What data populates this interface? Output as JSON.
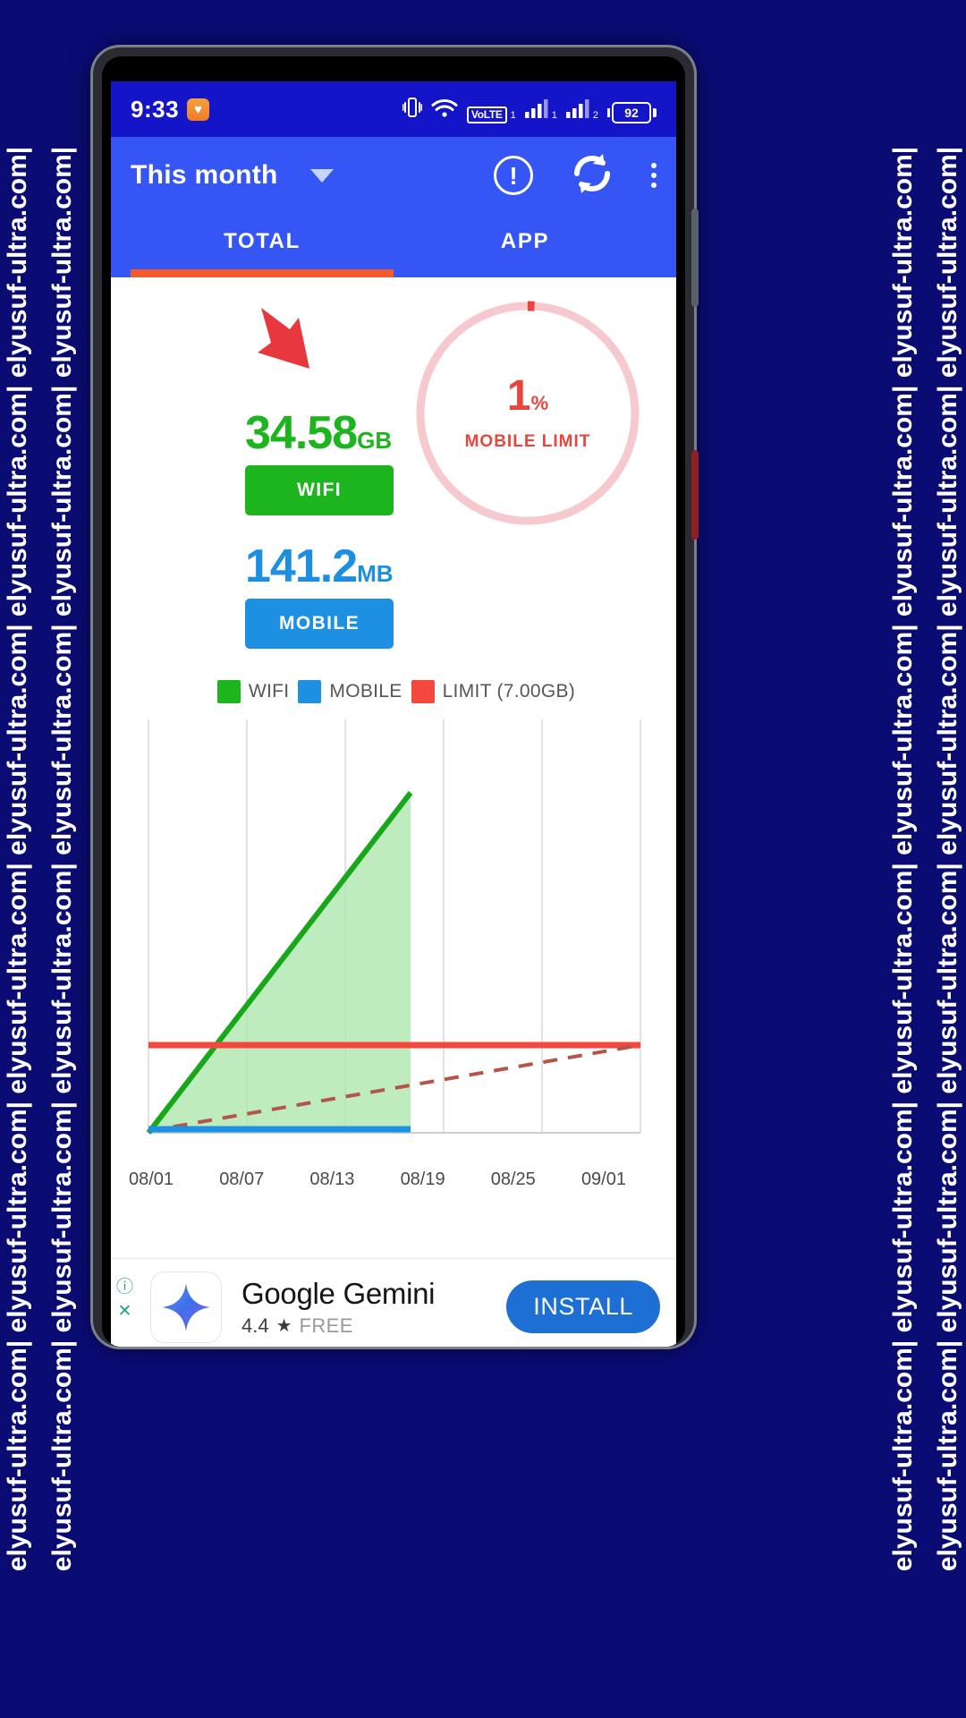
{
  "watermark": {
    "text": "elyusuf-ultra.com| elyusuf-ultra.com| elyusuf-ultra.com| elyusuf-ultra.com| elyusuf-ultra.com| elyusuf-ultra.com|"
  },
  "statusbar": {
    "time": "9:33",
    "notification_icon": "heart-shield-icon",
    "vibrate_icon": "vibrate-icon",
    "wifi_icon": "wifi-icon",
    "volte_label": "VoLTE",
    "volte_sim": "1",
    "signal1_icon": "signal-bars-icon",
    "signal1_sim": "1",
    "signal2_icon": "signal-bars-icon",
    "signal2_sim": "2",
    "battery_level": "92"
  },
  "appbar": {
    "period_label": "This month",
    "caret_icon": "chevron-down-icon",
    "info_icon": "exclamation-circle-icon",
    "refresh_icon": "refresh-icon",
    "overflow_icon": "more-vertical-icon"
  },
  "tabs": [
    {
      "label": "TOTAL",
      "active": true
    },
    {
      "label": "APP",
      "active": false
    }
  ],
  "stats": {
    "arrow_icon": "red-down-arrow-icon",
    "wifi": {
      "value": "34.58",
      "unit": "GB",
      "button": "WIFI",
      "color": "#1db51d"
    },
    "mobile": {
      "value": "141.2",
      "unit": "MB",
      "button": "MOBILE",
      "color": "#1d90e3"
    }
  },
  "gauge": {
    "percent": "1",
    "percent_symbol": "%",
    "label": "MOBILE LIMIT",
    "track_color": "#f6c9ce",
    "fill_color": "#e8453c",
    "value": 1
  },
  "chart_data": {
    "type": "area",
    "title": "",
    "xlabel": "",
    "ylabel": "",
    "x_ticks": [
      "08/01",
      "08/07",
      "08/13",
      "08/19",
      "08/25",
      "09/01"
    ],
    "grid": true,
    "legend_position": "top",
    "legend": [
      {
        "name": "WIFI",
        "color": "#1db51d"
      },
      {
        "name": "MOBILE",
        "color": "#1d90e3"
      },
      {
        "name": "LIMIT (7.00GB)",
        "color": "#f4483f"
      }
    ],
    "limit_value_gb": 7.0,
    "limit_label": "LIMIT (7.00GB)",
    "ylim": [
      0,
      40
    ],
    "series": [
      {
        "name": "WIFI",
        "type": "area",
        "color": "#1db51d",
        "x": [
          "08/01",
          "08/07",
          "08/13",
          "08/17"
        ],
        "values": [
          0,
          12.8,
          25.4,
          34.58
        ]
      },
      {
        "name": "MOBILE",
        "type": "line",
        "color": "#1d90e3",
        "x": [
          "08/01",
          "08/07",
          "08/13",
          "08/17"
        ],
        "values": [
          0.02,
          0.06,
          0.1,
          0.141
        ]
      },
      {
        "name": "LIMIT",
        "type": "line",
        "color": "#f4483f",
        "x": [
          "08/01",
          "09/01"
        ],
        "values": [
          7.0,
          7.0
        ]
      },
      {
        "name": "PROJECTION",
        "type": "dashed",
        "color": "#b5554a",
        "x": [
          "08/01",
          "09/01"
        ],
        "values": [
          0,
          7.0
        ]
      }
    ]
  },
  "ad": {
    "info_icon": "info-icon",
    "close_icon": "close-icon",
    "app_icon": "gemini-sparkle-icon",
    "title": "Google Gemini",
    "rating": "4.4",
    "star_icon": "star-icon",
    "price": "FREE",
    "cta": "INSTALL"
  }
}
